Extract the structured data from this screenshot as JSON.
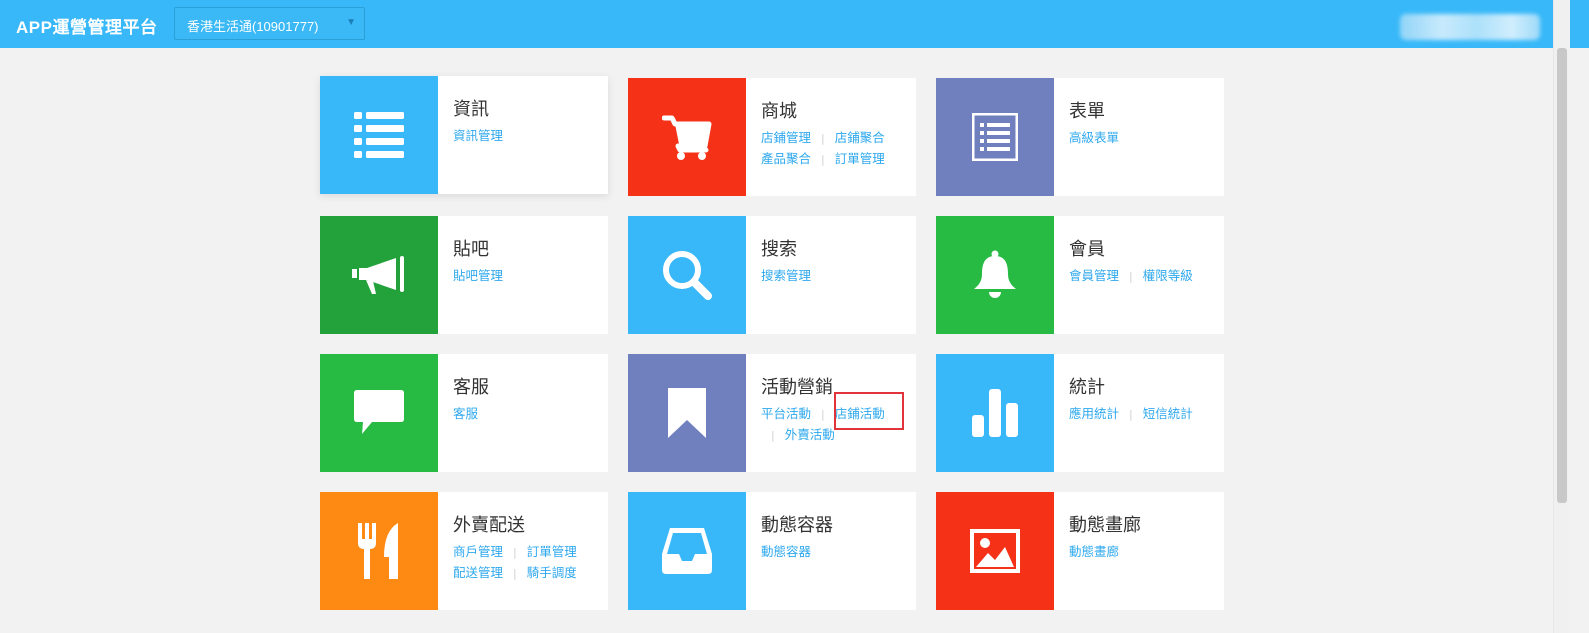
{
  "header": {
    "app_title": "APP運營管理平台",
    "store_select": {
      "selected": "香港生活通(10901777)",
      "caret": "▼"
    }
  },
  "colors": {
    "header_bg": "#38b8f8",
    "blue": "#38b8f8",
    "red": "#f53117",
    "purple": "#7080bf",
    "dark_green": "#23a23c",
    "green": "#27bb44",
    "orange": "#ff8a13",
    "link": "#2ea8ee",
    "highlight_box": "#e0333a"
  },
  "tiles": {
    "info": {
      "title": "資訊",
      "icon": "list-icon",
      "links": [
        "資訊管理"
      ]
    },
    "mall": {
      "title": "商城",
      "icon": "shopping-cart-icon",
      "links": [
        "店鋪管理",
        "店鋪聚合",
        "產品聚合",
        "訂單管理"
      ]
    },
    "forms": {
      "title": "表單",
      "icon": "form-document-icon",
      "links": [
        "高級表單"
      ]
    },
    "forum": {
      "title": "貼吧",
      "icon": "megaphone-icon",
      "links": [
        "貼吧管理"
      ]
    },
    "search": {
      "title": "搜索",
      "icon": "magnifier-icon",
      "links": [
        "搜索管理"
      ]
    },
    "members": {
      "title": "會員",
      "icon": "bell-icon",
      "links": [
        "會員管理",
        "權限等級"
      ]
    },
    "service": {
      "title": "客服",
      "icon": "chat-bubble-icon",
      "links": [
        "客服"
      ]
    },
    "marketing": {
      "title": "活動營銷",
      "icon": "bookmark-icon",
      "links": [
        "平台活動",
        "店鋪活動",
        "外賣活動"
      ],
      "highlighted": "店鋪活動"
    },
    "stats": {
      "title": "統計",
      "icon": "bar-chart-icon",
      "links": [
        "應用統計",
        "短信統計"
      ]
    },
    "delivery": {
      "title": "外賣配送",
      "icon": "fork-knife-icon",
      "links": [
        "商戶管理",
        "訂單管理",
        "配送管理",
        "騎手調度"
      ]
    },
    "container": {
      "title": "動態容器",
      "icon": "inbox-tray-icon",
      "links": [
        "動態容器"
      ]
    },
    "gallery": {
      "title": "動態畫廊",
      "icon": "image-icon",
      "links": [
        "動態畫廊"
      ]
    }
  }
}
